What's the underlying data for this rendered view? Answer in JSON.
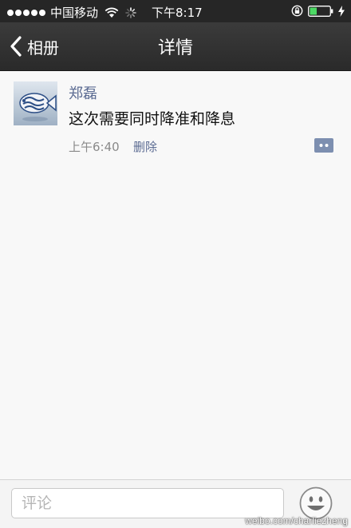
{
  "status_bar": {
    "carrier": "中国移动",
    "time": "下午8:17",
    "battery_color": "#4cd964"
  },
  "nav": {
    "back_label": "相册",
    "title": "详情",
    "back_icon": "chevron-left-icon"
  },
  "post": {
    "author": "郑磊",
    "text": "这次需要同时降准和降息",
    "time": "上午6:40",
    "delete_label": "删除",
    "comment_icon": "comment-bubble-icon",
    "accent_color": "#5b6b92"
  },
  "composer": {
    "placeholder": "评论",
    "emoji_icon": "smiley-icon"
  },
  "watermark": "weibo.com/charliezheng"
}
